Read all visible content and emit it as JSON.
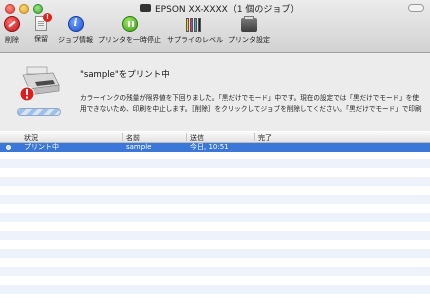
{
  "window": {
    "title": "EPSON XX-XXXX（1 個のジョブ）"
  },
  "toolbar": {
    "delete_label": "削除",
    "hold_label": "保留",
    "hold_badge": "!",
    "info_label": "ジョブ情報",
    "pause_label": "プリンタを一時停止",
    "supply_label": "サプライのレベル",
    "settings_label": "プリンタ設定",
    "supply_colors": [
      "#f5d500",
      "#e5317f",
      "#27a7e0",
      "#222222"
    ]
  },
  "status": {
    "job_title": "\"sample\"をプリント中",
    "message": "カラーインクの残量が限界値を下回りました。「黒だけでモード」中です。現在の設定では「黒だけでモード」を使用できないため、印刷を中止します。［削除］をクリックしてジョブを削除してください。「黒だけでモード」で印刷するには、（1）［「黒だけでモード」を使用する］"
  },
  "table": {
    "headers": [
      "状況",
      "名前",
      "送信",
      "完了"
    ],
    "rows": [
      {
        "status": "プリント中",
        "name": "sample",
        "sent": "今日, 10:51",
        "done": ""
      }
    ]
  },
  "colors": {
    "selection": "#3a77d8",
    "stripe": "#eef3fb"
  }
}
